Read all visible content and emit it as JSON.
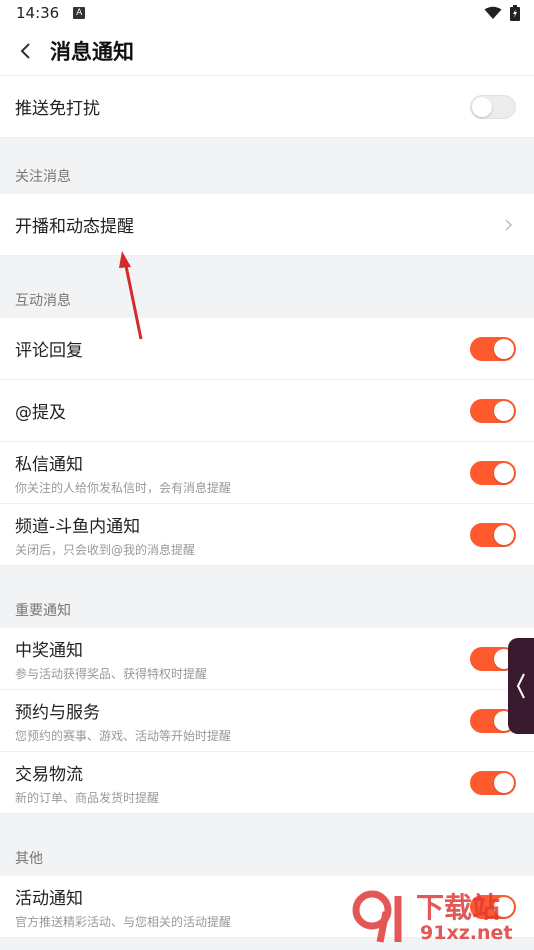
{
  "status_bar": {
    "time": "14:36",
    "a_icon": "A"
  },
  "header": {
    "title": "消息通知",
    "back_icon": "chevron-left-icon"
  },
  "dnd": {
    "label": "推送免打扰",
    "on": false
  },
  "sections": {
    "follow": {
      "header": "关注消息",
      "items": [
        {
          "label": "开播和动态提醒"
        }
      ]
    },
    "interact": {
      "header": "互动消息",
      "items": [
        {
          "label": "评论回复",
          "sub": "",
          "on": true
        },
        {
          "label": "@提及",
          "sub": "",
          "on": true
        },
        {
          "label": "私信通知",
          "sub": "你关注的人给你发私信时，会有消息提醒",
          "on": true
        },
        {
          "label": "频道-斗鱼内通知",
          "sub": "关闭后，只会收到@我的消息提醒",
          "on": true
        }
      ]
    },
    "important": {
      "header": "重要通知",
      "items": [
        {
          "label": "中奖通知",
          "sub": "参与活动获得奖品、获得特权时提醒",
          "on": true
        },
        {
          "label": "预约与服务",
          "sub": "您预约的赛事、游戏、活动等开始时提醒",
          "on": true
        },
        {
          "label": "交易物流",
          "sub": "新的订单、商品发货时提醒",
          "on": true
        }
      ]
    },
    "other": {
      "header": "其他",
      "items": [
        {
          "label": "活动通知",
          "sub": "官方推送精彩活动、与您相关的活动提醒",
          "on": true
        }
      ]
    }
  },
  "watermark": {
    "brand": "下载站",
    "domain": "91xz.net"
  },
  "colors": {
    "accent": "#ff5a2d",
    "arrow": "#d42a2a"
  }
}
